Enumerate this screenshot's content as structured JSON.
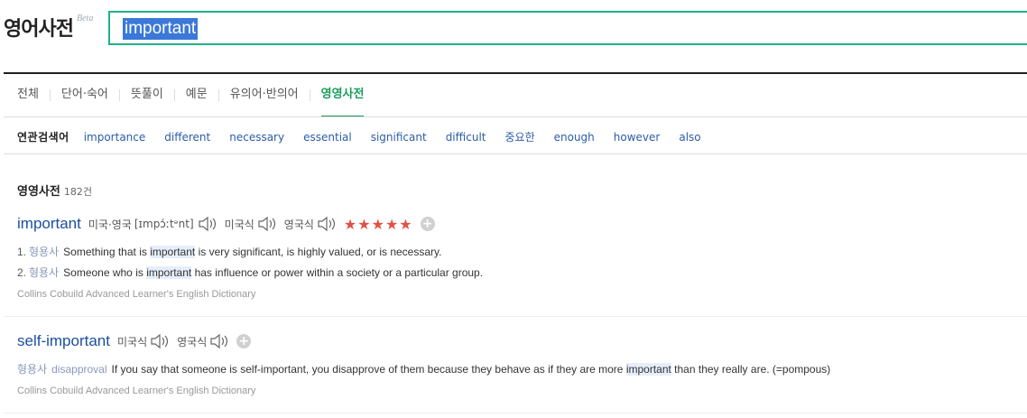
{
  "header": {
    "logo": "영어사전",
    "beta": "Beta",
    "search_value": "important"
  },
  "tabs": [
    {
      "label": "전체",
      "active": false
    },
    {
      "label": "단어·숙어",
      "active": false
    },
    {
      "label": "뜻풀이",
      "active": false
    },
    {
      "label": "예문",
      "active": false
    },
    {
      "label": "유의어·반의어",
      "active": false
    },
    {
      "label": "영영사전",
      "active": true
    }
  ],
  "related": {
    "label": "연관검색어",
    "items": [
      "importance",
      "different",
      "necessary",
      "essential",
      "significant",
      "difficult",
      "중요한",
      "enough",
      "however",
      "also"
    ]
  },
  "section": {
    "title": "영영사전",
    "count": "182건"
  },
  "entries": [
    {
      "headword": "important",
      "region_both": "미국·영국",
      "pron": "[ɪmpɔ́ːtᵊnt]",
      "us_label": "미국식",
      "uk_label": "영국식",
      "stars": "★★★★★",
      "defs": [
        {
          "num": "1.",
          "pos": "형용사",
          "pre": "Something that is ",
          "hl": "important",
          "post": " is very significant, is highly valued, or is necessary."
        },
        {
          "num": "2.",
          "pos": "형용사",
          "pre": "Someone who is ",
          "hl": "important",
          "post": " has influence or power within a society or a particular group."
        }
      ],
      "source": "Collins Cobuild Advanced Learner's English Dictionary"
    },
    {
      "headword": "self-important",
      "us_label": "미국식",
      "uk_label": "영국식",
      "def": {
        "pos": "형용사",
        "tag": "disapproval",
        "pre": "If you say that someone is self-important, you disapprove of them because they behave as if they are more ",
        "hl": "important",
        "post": " than they really are. (=pompous)"
      },
      "source": "Collins Cobuild Advanced Learner's English Dictionary"
    }
  ],
  "icons": {
    "speaker": "speaker-icon",
    "plus": "plus-icon"
  },
  "colors": {
    "accent_green": "#1a9c5b",
    "search_border": "#1fb08c",
    "link_blue": "#2b5ca8",
    "headword_blue": "#1b4fa0",
    "stars_red": "#e05245"
  }
}
